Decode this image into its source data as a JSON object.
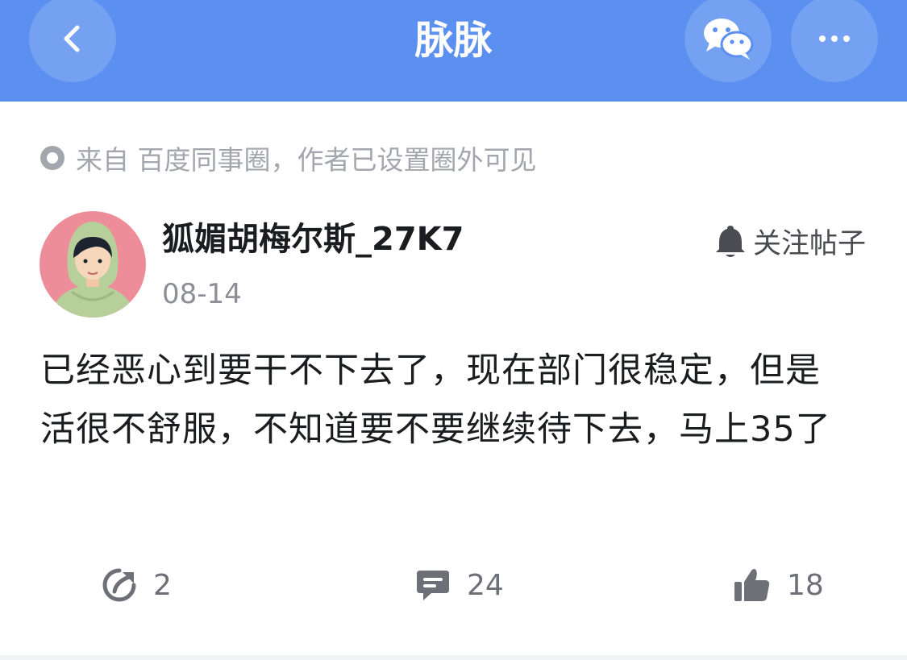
{
  "header": {
    "title": "脉脉",
    "back_icon": "chevron-left-icon",
    "share_icon": "wechat-icon",
    "more_icon": "more-dots-icon",
    "bg_color": "#5b8ff0"
  },
  "post": {
    "source_text": "来自 百度同事圈，作者已设置圈外可见",
    "author": {
      "name": "狐媚胡梅尔斯_27K7",
      "date": "08-14",
      "avatar": "avatar-hooded-person"
    },
    "follow_label": "关注帖子",
    "body": "已经恶心到要干不下去了，现在部门很稳定，但是活很不舒服，不知道要不要继续待下去，马上35了"
  },
  "actions": {
    "share_count": "2",
    "comment_count": "24",
    "like_count": "18"
  }
}
